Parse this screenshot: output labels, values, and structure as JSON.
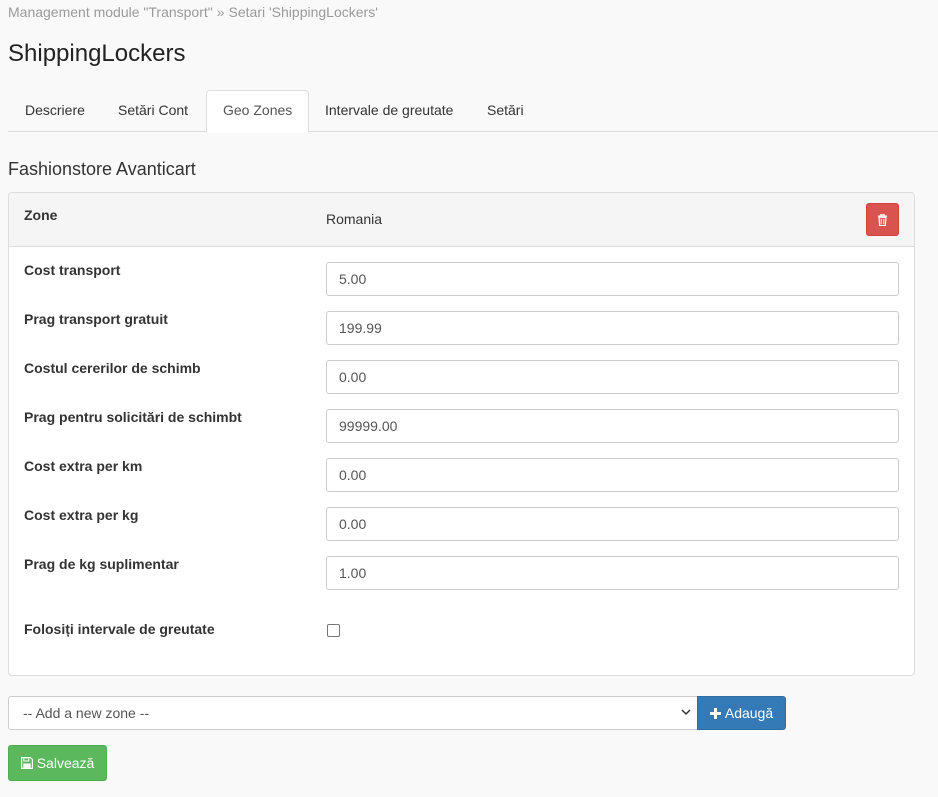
{
  "breadcrumb": {
    "parent": "Management module \"Transport\"",
    "separator": "»",
    "current": "Setari 'ShippingLockers'"
  },
  "page_title": "ShippingLockers",
  "tabs": [
    {
      "label": "Descriere",
      "active": false
    },
    {
      "label": "Setări Cont",
      "active": false
    },
    {
      "label": "Geo Zones",
      "active": true
    },
    {
      "label": "Intervale de greutate",
      "active": false
    },
    {
      "label": "Setări",
      "active": false
    }
  ],
  "store_title": "Fashionstore Avanticart",
  "zone": {
    "label": "Zone",
    "value": "Romania",
    "delete_icon": "trash-icon"
  },
  "fields": [
    {
      "label": "Cost transport",
      "value": "5.00"
    },
    {
      "label": "Prag transport gratuit",
      "value": "199.99"
    },
    {
      "label": "Costul cererilor de schimb",
      "value": "0.00"
    },
    {
      "label": "Prag pentru solicitări de schimbt",
      "value": "99999.00"
    },
    {
      "label": "Cost extra per km",
      "value": "0.00"
    },
    {
      "label": "Cost extra per kg",
      "value": "0.00"
    },
    {
      "label": "Prag de kg suplimentar",
      "value": "1.00"
    }
  ],
  "weight_intervals": {
    "label": "Folosiți intervale de greutate",
    "checked": false
  },
  "add_zone": {
    "select_value": "-- Add a new zone --",
    "button_label": "Adaugă",
    "button_icon": "plus-icon"
  },
  "save": {
    "label": "Salvează",
    "icon": "floppy-disk-icon"
  },
  "colors": {
    "danger": "#d9534f",
    "primary": "#337ab7",
    "success": "#5cb85c"
  }
}
